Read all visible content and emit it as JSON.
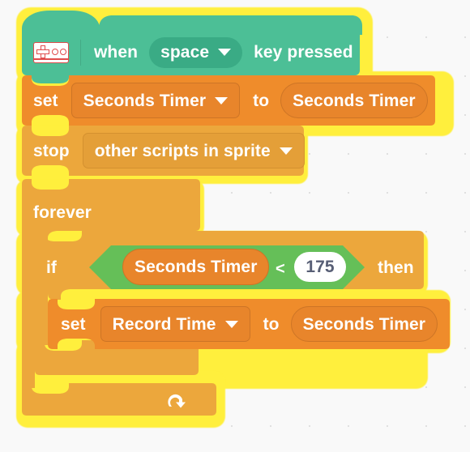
{
  "editor": {
    "name": "scratch-block-editor",
    "background_color": "#f9f9f9",
    "grid_dot_color": "#e0e0e0",
    "highlight_glow_color": "#ffef3d"
  },
  "palette": {
    "events_color": "#4cbf96",
    "variables_color": "#ef8c2b",
    "control_color": "#eca73c",
    "operators_color": "#65bf58",
    "input_text_color": "#575e75"
  },
  "script": {
    "blocks": [
      {
        "id": "when-key-pressed",
        "category": "events",
        "icon": "gamepad-icon",
        "text_before": "when",
        "dropdown_value": "space",
        "text_after": "key pressed"
      },
      {
        "id": "set-seconds-timer",
        "category": "variables",
        "text_before": "set",
        "dropdown_value": "Seconds Timer",
        "text_middle": "to",
        "reporter_value": "Seconds Timer"
      },
      {
        "id": "stop-other-scripts",
        "category": "control",
        "text_before": "stop",
        "dropdown_value": "other scripts in sprite"
      },
      {
        "id": "forever",
        "category": "control",
        "label": "forever",
        "loop_icon": "loop-arrow-icon"
      },
      {
        "id": "if-then",
        "category": "control",
        "text_before": "if",
        "text_after": "then",
        "condition": {
          "id": "less-than",
          "category": "operators",
          "left_operand": "Seconds Timer",
          "operator": "<",
          "right_operand": "175"
        }
      },
      {
        "id": "set-record-time",
        "category": "variables",
        "text_before": "set",
        "dropdown_value": "Record Time",
        "text_middle": "to",
        "reporter_value": "Seconds Timer"
      }
    ]
  }
}
